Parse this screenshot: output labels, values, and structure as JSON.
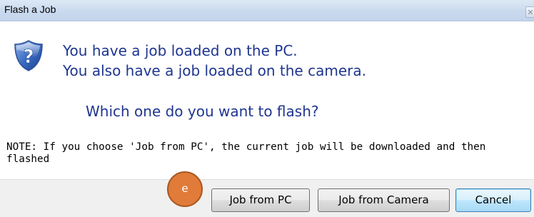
{
  "dialog": {
    "title": "Flash a Job",
    "close_glyph": "✕",
    "icon": "question-shield-icon",
    "message_line1": "You have a job loaded on the PC.",
    "message_line2": "You also have a job loaded on the camera.",
    "question": "Which one do you want to flash?",
    "note": "NOTE: If you choose 'Job from PC', the current job will be downloaded and then flashed"
  },
  "buttons": {
    "job_from_pc": "Job from PC",
    "job_from_camera": "Job from Camera",
    "cancel": "Cancel"
  },
  "annotation": {
    "marker_label": "e"
  },
  "colors": {
    "message_text": "#1f3690",
    "titlebar": "#c9d9ee",
    "marker": "#e07b3a"
  }
}
